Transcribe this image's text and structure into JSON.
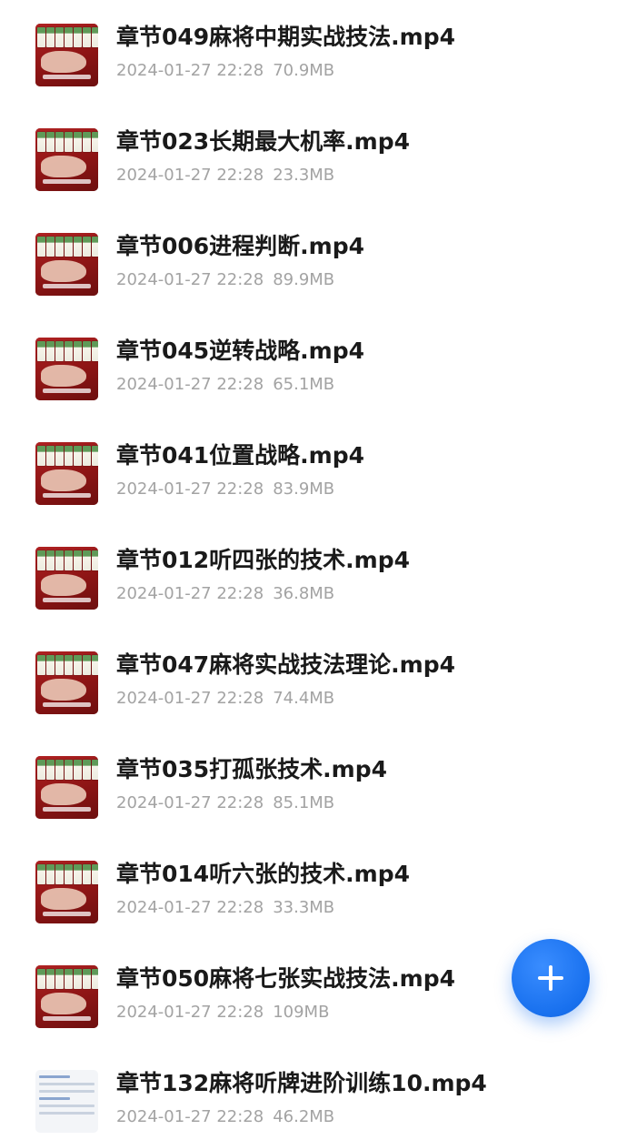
{
  "files": [
    {
      "name": "章节049麻将中期实战技法.mp4",
      "date": "2024-01-27 22:28",
      "size": "70.9MB",
      "thumb": "mahjong-video-thumbnail"
    },
    {
      "name": "章节023长期最大机率.mp4",
      "date": "2024-01-27 22:28",
      "size": "23.3MB",
      "thumb": "mahjong-video-thumbnail"
    },
    {
      "name": "章节006进程判断.mp4",
      "date": "2024-01-27 22:28",
      "size": "89.9MB",
      "thumb": "mahjong-video-thumbnail"
    },
    {
      "name": "章节045逆转战略.mp4",
      "date": "2024-01-27 22:28",
      "size": "65.1MB",
      "thumb": "mahjong-video-thumbnail"
    },
    {
      "name": "章节041位置战略.mp4",
      "date": "2024-01-27 22:28",
      "size": "83.9MB",
      "thumb": "mahjong-video-thumbnail"
    },
    {
      "name": "章节012听四张的技术.mp4",
      "date": "2024-01-27 22:28",
      "size": "36.8MB",
      "thumb": "mahjong-video-thumbnail"
    },
    {
      "name": "章节047麻将实战技法理论.mp4",
      "date": "2024-01-27 22:28",
      "size": "74.4MB",
      "thumb": "mahjong-video-thumbnail"
    },
    {
      "name": "章节035打孤张技术.mp4",
      "date": "2024-01-27 22:28",
      "size": "85.1MB",
      "thumb": "mahjong-video-thumbnail"
    },
    {
      "name": "章节014听六张的技术.mp4",
      "date": "2024-01-27 22:28",
      "size": "33.3MB",
      "thumb": "mahjong-video-thumbnail"
    },
    {
      "name": "章节050麻将七张实战技法.mp4",
      "date": "2024-01-27 22:28",
      "size": "109MB",
      "thumb": "mahjong-video-thumbnail"
    },
    {
      "name": "章节132麻将听牌进阶训练10.mp4",
      "date": "2024-01-27 22:28",
      "size": "46.2MB",
      "thumb": "document-video-thumbnail"
    }
  ],
  "fab": {
    "icon": "plus-icon",
    "color": "#1870ee"
  },
  "colors": {
    "title": "#1a1a1a",
    "meta": "#a3a3a3",
    "accent": "#1870ee"
  }
}
